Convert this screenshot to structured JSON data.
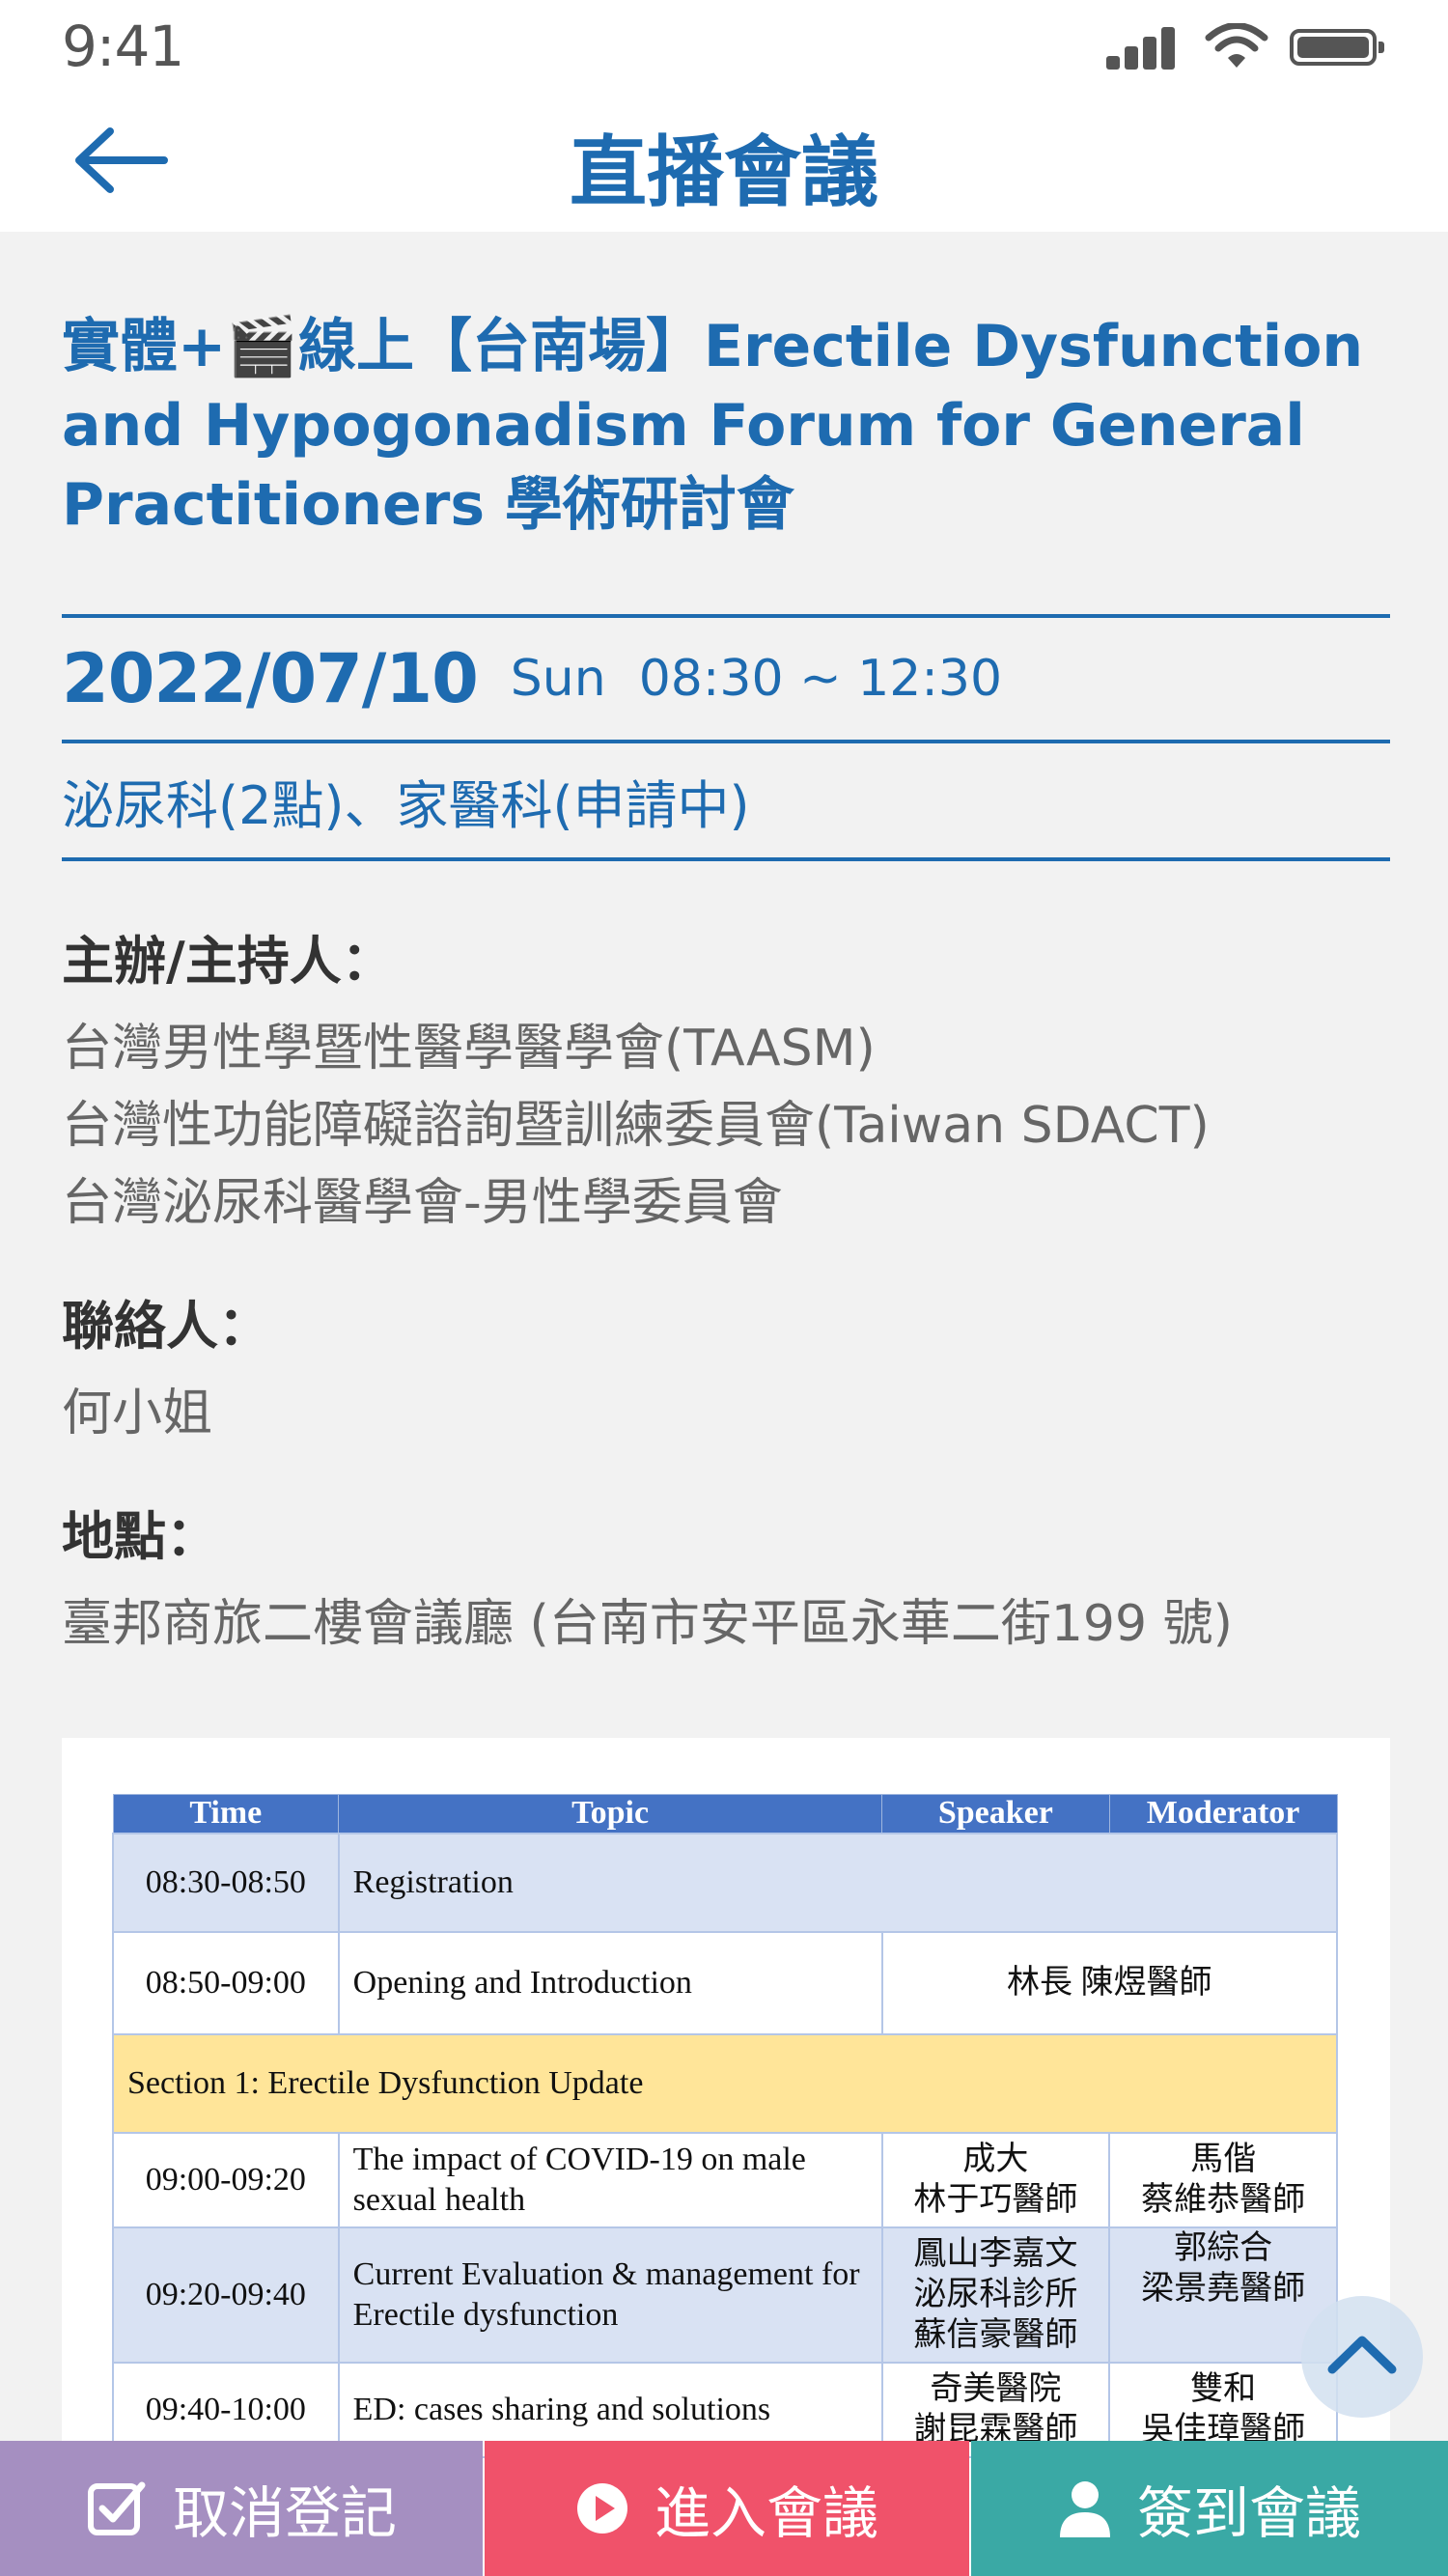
{
  "status_bar": {
    "time": "9:41"
  },
  "header": {
    "title": "直播會議"
  },
  "event": {
    "title": "實體+🎬線上【台南場】Erectile Dysfunction and Hypogonadism Forum for General Practitioners 學術研討會",
    "date": "2022/07/10",
    "day": "Sun",
    "time_range": "08:30 ~ 12:30",
    "credits": "泌尿科(2點)、家醫科(申請中)"
  },
  "organizers": {
    "label": "主辦/主持人：",
    "lines": [
      "台灣男性學暨性醫學醫學會(TAASM)",
      "台灣性功能障礙諮詢暨訓練委員會(Taiwan SDACT)",
      "台灣泌尿科醫學會-男性學委員會"
    ]
  },
  "contact": {
    "label": "聯絡人：",
    "value": "何小姐"
  },
  "location": {
    "label": "地點：",
    "value": "臺邦商旅二樓會議廳 (台南市安平區永華二街199 號)"
  },
  "agenda": {
    "headers": [
      "Time",
      "Topic",
      "Speaker",
      "Moderator"
    ],
    "rows": [
      {
        "time": "08:30-08:50",
        "topic": "Registration"
      },
      {
        "time": "08:50-09:00",
        "topic": "Opening and Introduction",
        "merged": "林長  陳煜醫師"
      },
      {
        "section": "Section 1:    Erectile Dysfunction Update"
      },
      {
        "time": "09:00-09:20",
        "topic": "The impact of COVID-19 on male sexual health",
        "speaker": [
          "成大",
          "林于巧醫師"
        ],
        "moderator": [
          "馬偕",
          "蔡維恭醫師"
        ]
      },
      {
        "time": "09:20-09:40",
        "topic": "Current Evaluation & management for Erectile dysfunction",
        "speaker": [
          "鳳山李嘉文",
          "泌尿科診所",
          "蘇信豪醫師"
        ],
        "moderator": [
          "郭綜合",
          "梁景堯醫師"
        ]
      },
      {
        "time": "09:40-10:00",
        "topic": "ED: cases sharing and solutions",
        "speaker": [
          "奇美醫院",
          "謝昆霖醫師"
        ],
        "moderator": [
          "雙和",
          "吳佳璋醫師"
        ]
      }
    ]
  },
  "actions": {
    "cancel": "取消登記",
    "enter": "進入會議",
    "checkin": "簽到會議"
  },
  "colors": {
    "primary": "#1e6bb0",
    "cancel": "#a58fc1",
    "enter": "#f0526a",
    "checkin": "#3aa9a5",
    "table_header": "#4472c4",
    "table_blue": "#d9e2f3",
    "table_section": "#ffe599"
  }
}
